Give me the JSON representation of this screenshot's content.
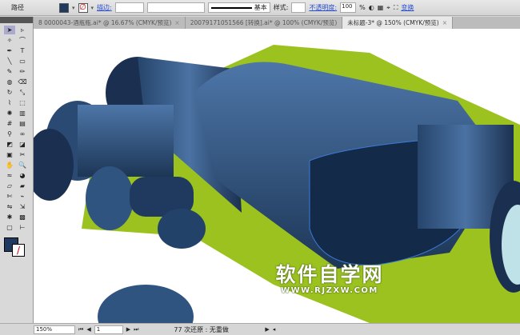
{
  "control_bar": {
    "selection_label": "路径",
    "stroke_link": "描边:",
    "style_label": "样式:",
    "opacity_link": "不透明度:",
    "opacity_value": "100",
    "percent": "%",
    "basic_label": "基本",
    "transform_link": "变换",
    "fill_color": "#1e3a5f"
  },
  "tabs": [
    {
      "label": "8 0000043-酒瓶瓶.ai* @ 16.67% (CMYK/预览)",
      "active": false
    },
    {
      "label": "20079171051566 [转换].ai* @ 100% (CMYK/预览)",
      "active": false
    },
    {
      "label": "未标题-3* @ 150% (CMYK/预览)",
      "active": true
    }
  ],
  "tools": [
    "selection",
    "direct-selection",
    "magic-wand",
    "lasso",
    "pen",
    "type",
    "line",
    "rectangle",
    "paintbrush",
    "pencil",
    "blob-brush",
    "eraser",
    "rotate",
    "scale",
    "warp",
    "free-transform",
    "symbol-sprayer",
    "column-graph",
    "mesh",
    "gradient",
    "eyedropper",
    "blend",
    "live-paint",
    "live-paint-selection",
    "artboard",
    "slice",
    "hand",
    "zoom",
    "width",
    "shape-builder",
    "perspective",
    "perspective-select",
    "scissors",
    "knife",
    "reflect",
    "shear",
    "puppet",
    "chart",
    "crop",
    "measure"
  ],
  "status": {
    "zoom": "150%",
    "page": "1",
    "message": "77 次还原 : 无重做"
  },
  "watermark": {
    "title": "软件自学网",
    "url": "WWW.RJZXW.COM"
  },
  "colors": {
    "green": "#9cc21f",
    "blue": "#2f5480",
    "dark": "#1b3050"
  }
}
